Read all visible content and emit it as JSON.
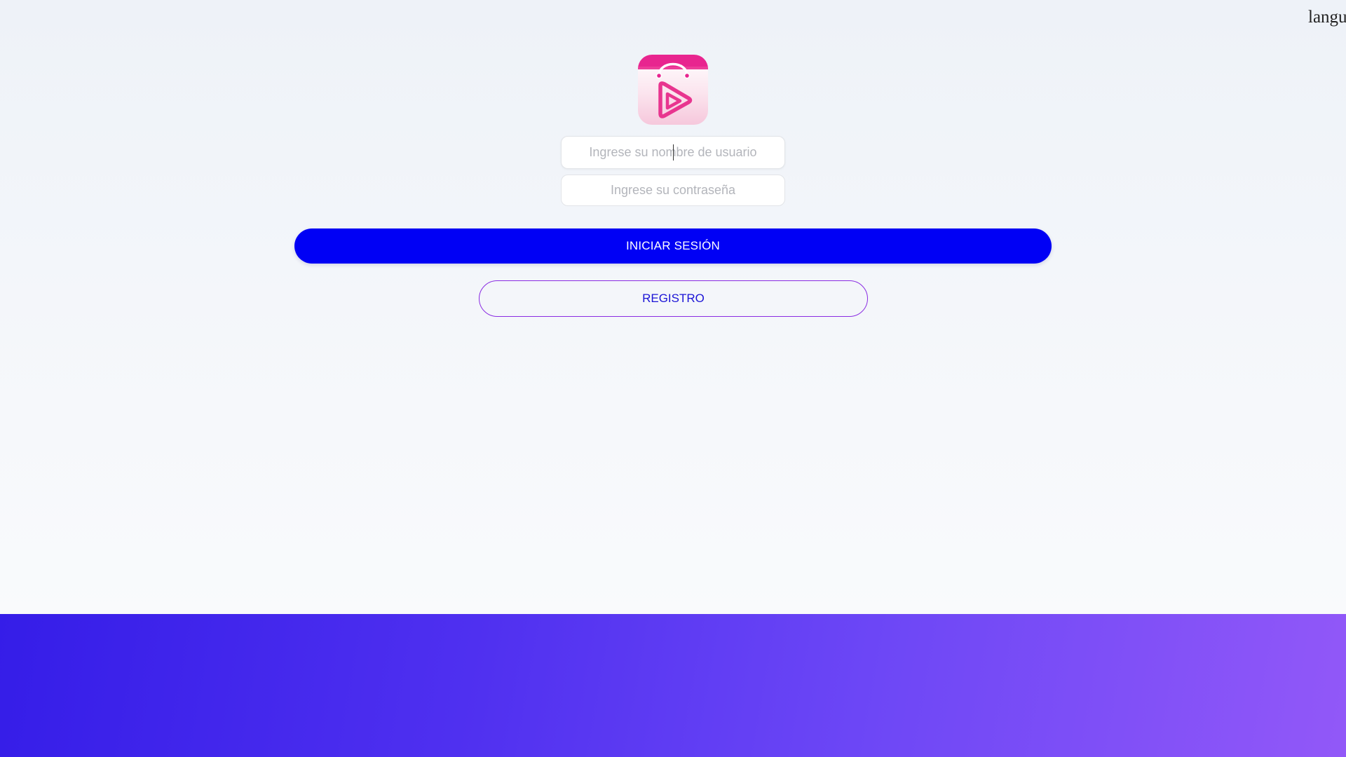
{
  "header": {
    "language_label": "langu"
  },
  "logo": {
    "icon": "shopping-bag-play-icon",
    "top_color": "#e8258f",
    "accent_color": "#e8358f"
  },
  "login_form": {
    "username_placeholder": "Ingrese su nombre de usuario",
    "username_value": "",
    "password_placeholder": "Ingrese su contraseña",
    "password_value": "",
    "login_button_label": "INICIAR SESIÓN",
    "register_button_label": "REGISTRO"
  },
  "colors": {
    "login_button": "#0000f5",
    "register_border": "#8a2be2",
    "register_text": "#1c14d6",
    "bottom_band_start": "#351de8",
    "bottom_band_end": "#9258f8"
  }
}
